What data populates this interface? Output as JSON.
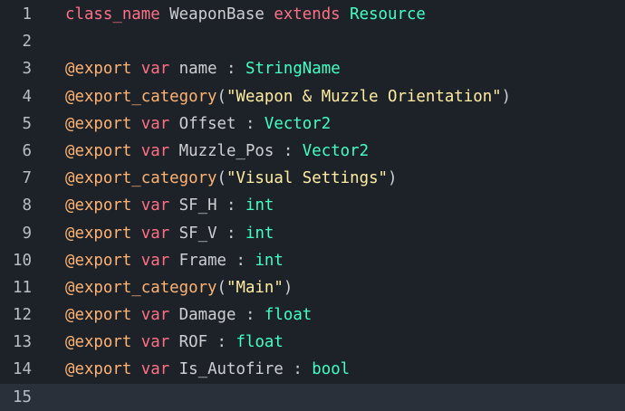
{
  "colors": {
    "background": "#1d2229",
    "current_line": "#2a303a",
    "keyword": "#ff7085",
    "annotation": "#ffb373",
    "type": "#42ffc2",
    "string": "#ffeda1",
    "text": "#cdcfd2",
    "line_number": "#b9bec6"
  },
  "lines": [
    {
      "number": "1",
      "tokens": [
        {
          "text": "class_name",
          "kind": "kw"
        },
        {
          "text": " WeaponBase ",
          "kind": "id"
        },
        {
          "text": "extends",
          "kind": "kw"
        },
        {
          "text": " ",
          "kind": "id"
        },
        {
          "text": "Resource",
          "kind": "type"
        }
      ]
    },
    {
      "number": "2",
      "tokens": []
    },
    {
      "number": "3",
      "tokens": [
        {
          "text": "@export",
          "kind": "anno"
        },
        {
          "text": " ",
          "kind": "id"
        },
        {
          "text": "var",
          "kind": "kw"
        },
        {
          "text": " name : ",
          "kind": "id"
        },
        {
          "text": "StringName",
          "kind": "type"
        }
      ]
    },
    {
      "number": "4",
      "tokens": [
        {
          "text": "@export_category",
          "kind": "anno"
        },
        {
          "text": "(",
          "kind": "punct"
        },
        {
          "text": "\"Weapon & Muzzle Orientation\"",
          "kind": "str"
        },
        {
          "text": ")",
          "kind": "punct"
        }
      ]
    },
    {
      "number": "5",
      "tokens": [
        {
          "text": "@export",
          "kind": "anno"
        },
        {
          "text": " ",
          "kind": "id"
        },
        {
          "text": "var",
          "kind": "kw"
        },
        {
          "text": " Offset : ",
          "kind": "id"
        },
        {
          "text": "Vector2",
          "kind": "type"
        }
      ]
    },
    {
      "number": "6",
      "tokens": [
        {
          "text": "@export",
          "kind": "anno"
        },
        {
          "text": " ",
          "kind": "id"
        },
        {
          "text": "var",
          "kind": "kw"
        },
        {
          "text": " Muzzle_Pos : ",
          "kind": "id"
        },
        {
          "text": "Vector2",
          "kind": "type"
        }
      ]
    },
    {
      "number": "7",
      "tokens": [
        {
          "text": "@export_category",
          "kind": "anno"
        },
        {
          "text": "(",
          "kind": "punct"
        },
        {
          "text": "\"Visual Settings\"",
          "kind": "str"
        },
        {
          "text": ")",
          "kind": "punct"
        }
      ]
    },
    {
      "number": "8",
      "tokens": [
        {
          "text": "@export",
          "kind": "anno"
        },
        {
          "text": " ",
          "kind": "id"
        },
        {
          "text": "var",
          "kind": "kw"
        },
        {
          "text": " SF_H : ",
          "kind": "id"
        },
        {
          "text": "int",
          "kind": "type"
        }
      ]
    },
    {
      "number": "9",
      "tokens": [
        {
          "text": "@export",
          "kind": "anno"
        },
        {
          "text": " ",
          "kind": "id"
        },
        {
          "text": "var",
          "kind": "kw"
        },
        {
          "text": " SF_V : ",
          "kind": "id"
        },
        {
          "text": "int",
          "kind": "type"
        }
      ]
    },
    {
      "number": "10",
      "tokens": [
        {
          "text": "@export",
          "kind": "anno"
        },
        {
          "text": " ",
          "kind": "id"
        },
        {
          "text": "var",
          "kind": "kw"
        },
        {
          "text": " Frame : ",
          "kind": "id"
        },
        {
          "text": "int",
          "kind": "type"
        }
      ]
    },
    {
      "number": "11",
      "tokens": [
        {
          "text": "@export_category",
          "kind": "anno"
        },
        {
          "text": "(",
          "kind": "punct"
        },
        {
          "text": "\"Main\"",
          "kind": "str"
        },
        {
          "text": ")",
          "kind": "punct"
        }
      ]
    },
    {
      "number": "12",
      "tokens": [
        {
          "text": "@export",
          "kind": "anno"
        },
        {
          "text": " ",
          "kind": "id"
        },
        {
          "text": "var",
          "kind": "kw"
        },
        {
          "text": " Damage : ",
          "kind": "id"
        },
        {
          "text": "float",
          "kind": "type"
        }
      ]
    },
    {
      "number": "13",
      "tokens": [
        {
          "text": "@export",
          "kind": "anno"
        },
        {
          "text": " ",
          "kind": "id"
        },
        {
          "text": "var",
          "kind": "kw"
        },
        {
          "text": " ROF : ",
          "kind": "id"
        },
        {
          "text": "float",
          "kind": "type"
        }
      ]
    },
    {
      "number": "14",
      "tokens": [
        {
          "text": "@export",
          "kind": "anno"
        },
        {
          "text": " ",
          "kind": "id"
        },
        {
          "text": "var",
          "kind": "kw"
        },
        {
          "text": " Is_Autofire : ",
          "kind": "id"
        },
        {
          "text": "bool",
          "kind": "type"
        }
      ]
    },
    {
      "number": "15",
      "tokens": [],
      "current": true
    }
  ]
}
